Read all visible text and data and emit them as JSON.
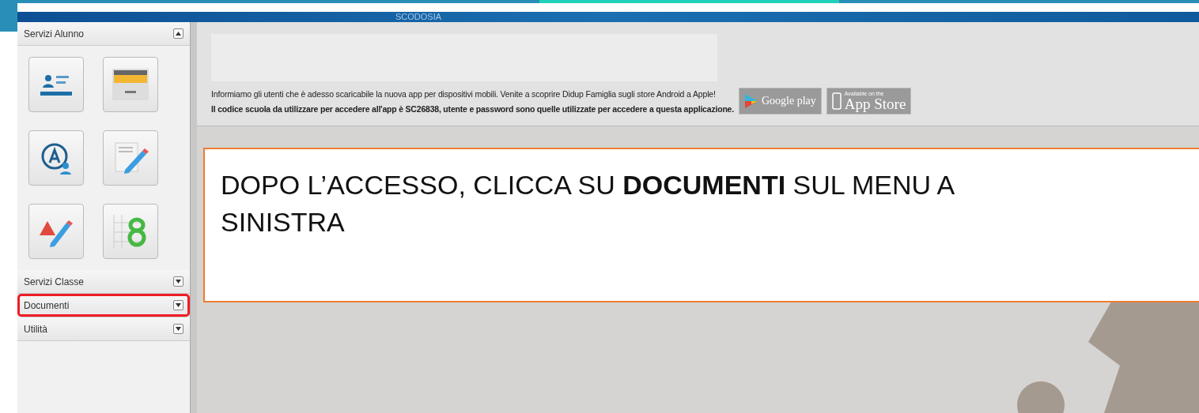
{
  "header": {
    "title": "SCODOSIA"
  },
  "sidebar": {
    "sections": [
      {
        "label": "Servizi Alunno",
        "expanded": true,
        "highlighted": false,
        "tiles": [
          {
            "kind": "student-card"
          },
          {
            "kind": "folder"
          },
          {
            "kind": "absence"
          },
          {
            "kind": "grade-pencil"
          },
          {
            "kind": "note-alert"
          },
          {
            "kind": "grade-grid"
          }
        ]
      },
      {
        "label": "Servizi Classe",
        "expanded": false,
        "highlighted": false
      },
      {
        "label": "Documenti",
        "expanded": false,
        "highlighted": true
      },
      {
        "label": "Utilità",
        "expanded": false,
        "highlighted": false
      }
    ]
  },
  "notice": {
    "line_1": "Informiamo gli utenti che è adesso scaricabile la nuova app per dispositivi mobili. Venite a scoprire Didup Famiglia sugli store Android a Apple!",
    "line_2": "Il codice scuola da utilizzare per accedere all'app è SC26838, utente e password sono quelle utilizzate per accedere a questa applicazione.",
    "badges": [
      {
        "kind": "google",
        "label": "Google play"
      },
      {
        "kind": "apple",
        "caption": "Available on the",
        "label": "App Store"
      }
    ]
  },
  "callout": {
    "text": "DOPO L’ACCESSO, CLICCA SU **DOCUMENTI** SUL MENU A SINISTRA"
  }
}
